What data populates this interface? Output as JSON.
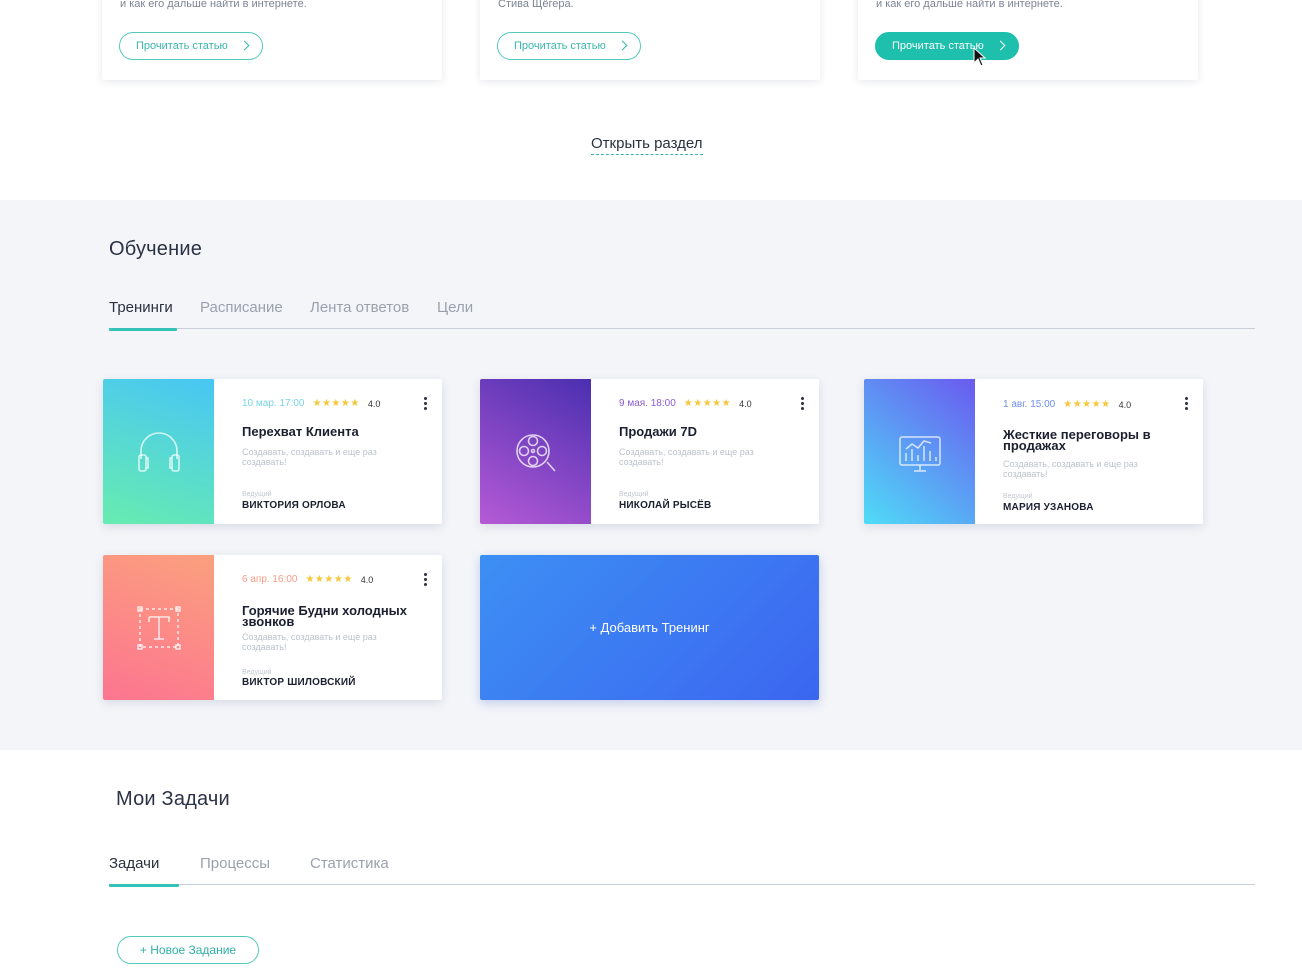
{
  "articles": [
    {
      "snippet": "и как его дальше найти в интернете.",
      "button": "Прочитать статью"
    },
    {
      "snippet": "Стива Щёгера.",
      "button": "Прочитать статью"
    },
    {
      "snippet": "и как его дальше найти в интернете.",
      "button": "Прочитать статью"
    }
  ],
  "open_section": "Открыть раздел",
  "training": {
    "title": "Обучение",
    "tabs": [
      "Тренинги",
      "Расписание",
      "Лента ответов",
      "Цели"
    ],
    "host_label": "Ведущий",
    "stars": "★★★★★",
    "cards": [
      {
        "date": "10 мар. 17:00",
        "rating": "4.0",
        "title": "Перехват Клиента",
        "desc": "Создавать, создавать и еще раз создавать!",
        "host": "ВИКТОРИЯ ОРЛОВА",
        "icon": "headphones-icon",
        "date_color": "#7ad3e0"
      },
      {
        "date": "9 мая. 18:00",
        "rating": "4.0",
        "title": "Продажи 7D",
        "desc": "Создавать, создавать и еще раз создавать!",
        "host": "НИКОЛАЙ РЫСЁВ",
        "icon": "film-reel-icon",
        "date_color": "#8b5cd6"
      },
      {
        "date": "1 авг. 15:00",
        "rating": "4.0",
        "title": "Жесткие переговоры в продажах",
        "desc": "Создавать, создавать и еще раз создавать!",
        "host": "МАРИЯ УЗАНОВА",
        "icon": "analytics-monitor-icon",
        "date_color": "#6f8ff2"
      },
      {
        "date": "6 апр. 16:00",
        "rating": "4.0",
        "title": "Горячие Будни холодных звонков",
        "desc": "Создавать, создавать и еще раз создавать!",
        "host": "ВИКТОР ШИЛОВСКИЙ",
        "icon": "text-frame-icon",
        "date_color": "#f79d86"
      }
    ],
    "add_label": "+ Добавить Тренинг"
  },
  "tasks": {
    "title": "Мои Задачи",
    "tabs": [
      "Задачи",
      "Процессы",
      "Статистика"
    ],
    "new_task": "+ Новое Задание"
  },
  "colors": {
    "accent": "#35c2b6",
    "add_button": "#3b6ef0",
    "section_bg": "#f3f5f9"
  }
}
